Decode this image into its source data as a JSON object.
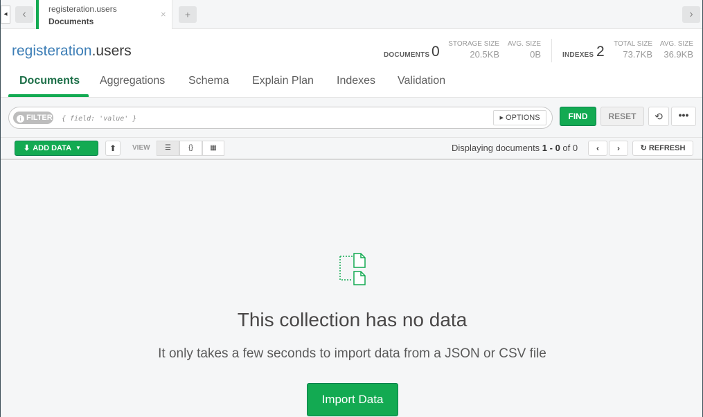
{
  "tabbar": {
    "collapse_glyph": "◂",
    "back_glyph": "‹",
    "forward_glyph": "›",
    "add_glyph": "+",
    "tab": {
      "namespace": "registeration.users",
      "subtitle": "Documents",
      "close_glyph": "×"
    }
  },
  "header": {
    "db_name": "registeration",
    "collection_name": ".users",
    "documents_label": "DOCUMENTS",
    "documents_count": "0",
    "storage_size_label": "STORAGE SIZE",
    "storage_size_value": "20.5KB",
    "avg_size_label": "AVG. SIZE",
    "avg_size_value": "0B",
    "indexes_label": "INDEXES",
    "indexes_count": "2",
    "total_size_label": "TOTAL SIZE",
    "total_size_value": "73.7KB",
    "idx_avg_size_label": "AVG. SIZE",
    "idx_avg_size_value": "36.9KB",
    "tabs": [
      {
        "label": "Documents",
        "active": true
      },
      {
        "label": "Aggregations",
        "active": false
      },
      {
        "label": "Schema",
        "active": false
      },
      {
        "label": "Explain Plan",
        "active": false
      },
      {
        "label": "Indexes",
        "active": false
      },
      {
        "label": "Validation",
        "active": false
      }
    ]
  },
  "querybar": {
    "filter_label": "FILTER",
    "filter_info_glyph": "i",
    "filter_placeholder": "{ field: 'value' }",
    "options_label": "▸ OPTIONS",
    "find_label": "FIND",
    "reset_label": "RESET",
    "history_glyph": "⟲",
    "more_glyph": "•••"
  },
  "toolbar": {
    "add_data_label": "ADD DATA",
    "add_data_icon": "⬇",
    "add_data_caret": "▼",
    "export_icon": "⬆",
    "view_label": "VIEW",
    "view_list_glyph": "☰",
    "view_json_glyph": "{}",
    "view_table_glyph": "▦",
    "display_prefix": "Displaying documents ",
    "display_range": "1 - 0",
    "display_suffix": " of 0",
    "prev_glyph": "‹",
    "next_glyph": "›",
    "refresh_label": "REFRESH",
    "refresh_icon": "↻"
  },
  "empty_state": {
    "title": "This collection has no data",
    "subtitle": "It only takes a few seconds to import data from a JSON or CSV file",
    "import_label": "Import Data"
  },
  "colors": {
    "accent_green": "#13aa52",
    "db_blue": "#3d7eb6"
  }
}
